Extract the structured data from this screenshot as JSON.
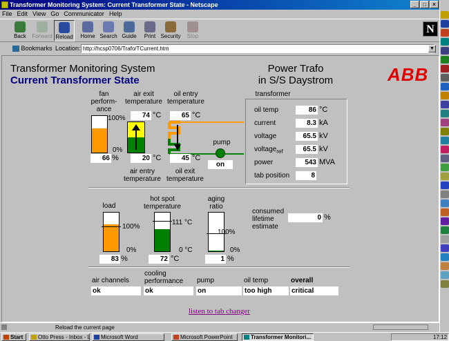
{
  "window": {
    "title": "Transformer Monitoring System: Current Transformer State - Netscape",
    "minimize": "_",
    "maximize": "□",
    "close": "×"
  },
  "menu": [
    "File",
    "Edit",
    "View",
    "Go",
    "Communicator",
    "Help"
  ],
  "toolbar": {
    "buttons": [
      "Back",
      "Forward",
      "Reload",
      "Home",
      "Search",
      "Guide",
      "Print",
      "Security",
      "Stop"
    ]
  },
  "location": {
    "bookmarks_label": "Bookmarks",
    "location_label": "Location:",
    "url": "http://hcsp0706/Trafo/TCurrent.htm"
  },
  "header": {
    "system_title": "Transformer Monitoring System",
    "page_title": "Current Transformer State",
    "trafo_line1": "Power Trafo",
    "trafo_line2": "in S/S Daystrom",
    "logo": "ABB"
  },
  "top_section": {
    "fan_label": "fan\nperform-\nance",
    "fan_percent": 66,
    "fan_value": "66",
    "fan_unit": "%",
    "fan_max": "100%",
    "fan_min": "0%",
    "air_exit_label": "air exit\ntemperature",
    "air_exit_value": "74",
    "air_entry_value": "20",
    "air_entry_label": "air entry\ntemperature",
    "temp_unit": "°C",
    "oil_entry_label": "oil entry\ntemperature",
    "oil_entry_value": "65",
    "oil_exit_value": "45",
    "oil_exit_label": "oil exit\ntemperature",
    "pump_label": "pump",
    "pump_state": "on"
  },
  "transformer": {
    "title": "transformer",
    "rows": [
      {
        "label": "oil temp",
        "value": "86",
        "unit": "°C"
      },
      {
        "label": "current",
        "value": "8.3",
        "unit": "kA"
      },
      {
        "label": "voltage",
        "value": "65.5",
        "unit": "kV"
      },
      {
        "label": "voltage",
        "sub": "ref",
        "value": "65.5",
        "unit": "kV"
      },
      {
        "label": "power",
        "value": "543",
        "unit": "MVA"
      },
      {
        "label": "tab position",
        "value": "8",
        "unit": ""
      }
    ]
  },
  "mid_section": {
    "load_label": "load",
    "load_percent": 83,
    "load_value": "83",
    "load_unit": "%",
    "load_max": "100%",
    "load_min": "0%",
    "hotspot_label": "hot spot\ntemperature",
    "hotspot_value": "72",
    "hotspot_unit": "°C",
    "hotspot_max": "111 °C",
    "hotspot_min": "0 °C",
    "aging_label": "aging\nratio",
    "aging_value": "1",
    "aging_unit": "%",
    "aging_max": "100%",
    "aging_min": "0%",
    "consumed_label": "consumed\nlifetime\nestimate",
    "consumed_value": "0",
    "consumed_unit": "%"
  },
  "status_section": {
    "headers": [
      "air channels",
      "cooling\nperformance",
      "pump",
      "oil temp",
      "overall"
    ],
    "values": [
      "ok",
      "ok",
      "on",
      "too high",
      "critical"
    ]
  },
  "link": "listen to tab changer",
  "statusbar": "Reload the current page",
  "taskbar": {
    "start": "Start",
    "tasks": [
      "Otto Press - Inbox - Lotus ...",
      "Microsoft Word",
      "Microsoft PowerPoint",
      "Transformer Monitori..."
    ],
    "clock": "17:12"
  },
  "colors": {
    "title_blue": "#000080",
    "fill_orange": "#ff9900",
    "fill_green": "#008000",
    "fill_yellow": "#ffff00",
    "abb_red": "#e00000",
    "link_purple": "#800080"
  }
}
